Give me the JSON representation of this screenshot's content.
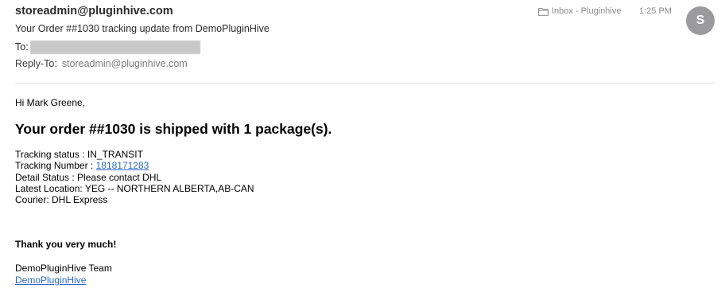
{
  "header": {
    "from": "storeadmin@pluginhive.com",
    "subject": "Your Order ##1030 tracking update from DemoPluginHive",
    "to_label": "To:",
    "reply_to_label": "Reply-To:",
    "reply_to_value": "storeadmin@pluginhive.com",
    "mailbox": "Inbox - Pluginhive",
    "time": "1:25 PM",
    "avatar_initial": "S"
  },
  "body": {
    "greeting": "Hi Mark Greene,",
    "headline": "Your order ##1030 is shipped with 1 package(s).",
    "tracking_status_label": "Tracking status : ",
    "tracking_status_value": "IN_TRANSIT",
    "tracking_number_label": "Tracking Number : ",
    "tracking_number_value": "1818171283",
    "detail_status_label": "Detail Status : ",
    "detail_status_value": "Please contact DHL",
    "latest_location_label": "Latest Location: ",
    "latest_location_value": "YEG -- NORTHERN ALBERTA,AB-CAN",
    "courier_label": "Courier: ",
    "courier_value": "DHL Express",
    "thanks": "Thank you very much!",
    "team": "DemoPluginHive Team",
    "store_link": "DemoPluginHive"
  },
  "icons": {
    "folder": "folder-icon"
  },
  "colors": {
    "link": "#2a67c9",
    "avatar_bg": "#9b9b9f",
    "muted_text": "#8a8a8a"
  }
}
